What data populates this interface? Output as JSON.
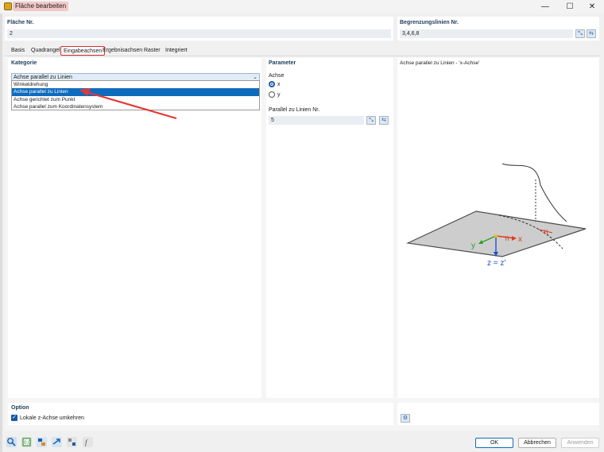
{
  "window": {
    "title": "Fläche bearbeiten",
    "minimize": "—",
    "maximize": "☐",
    "close": "✕"
  },
  "header": {
    "flaeche_label": "Fläche Nr.",
    "flaeche_value": "2",
    "linien_label": "Begrenzungslinien Nr.",
    "linien_value": "3,4,6,8"
  },
  "tabs": [
    {
      "label": "Basis"
    },
    {
      "label": "Quadrangel"
    },
    {
      "label": "Eingabeachsen",
      "active": true
    },
    {
      "label": "Ergebnisachsen"
    },
    {
      "label": "Raster"
    },
    {
      "label": "Integriert"
    }
  ],
  "kategorie": {
    "title": "Kategorie",
    "selected": "Achse parallel zu Linien",
    "options": [
      "Winkeldrehung",
      "Achse parallel zu Linien",
      "Achse gerichtet zum Punkt",
      "Achse parallel zum Koordinatensystem"
    ]
  },
  "parameter": {
    "title": "Parameter",
    "achse_label": "Achse",
    "radio_x": "x",
    "radio_y": "y",
    "selected_axis": "x",
    "parallel_label": "Parallel zu Linien Nr.",
    "parallel_value": "5"
  },
  "preview": {
    "title": "Achse parallel zu Linien - 'x-Achse'",
    "label_y": "y",
    "label_x": "x",
    "label_z": "z = z'",
    "colors": {
      "x": "#e03c1f",
      "y": "#2aa02a",
      "z": "#1f4fd0",
      "plate": "#cdcdcd"
    }
  },
  "option": {
    "title": "Option",
    "checkbox_label": "Lokale z-Achse umkehren",
    "checked": true
  },
  "footer": {
    "ok": "OK",
    "cancel": "Abbrechen",
    "apply": "Anwenden"
  },
  "icons": [
    "app-icon",
    "pick-icon",
    "reverse-icon",
    "search-icon",
    "calc-icon",
    "units-icon",
    "arrow-icon",
    "settings-icon",
    "function-icon"
  ]
}
